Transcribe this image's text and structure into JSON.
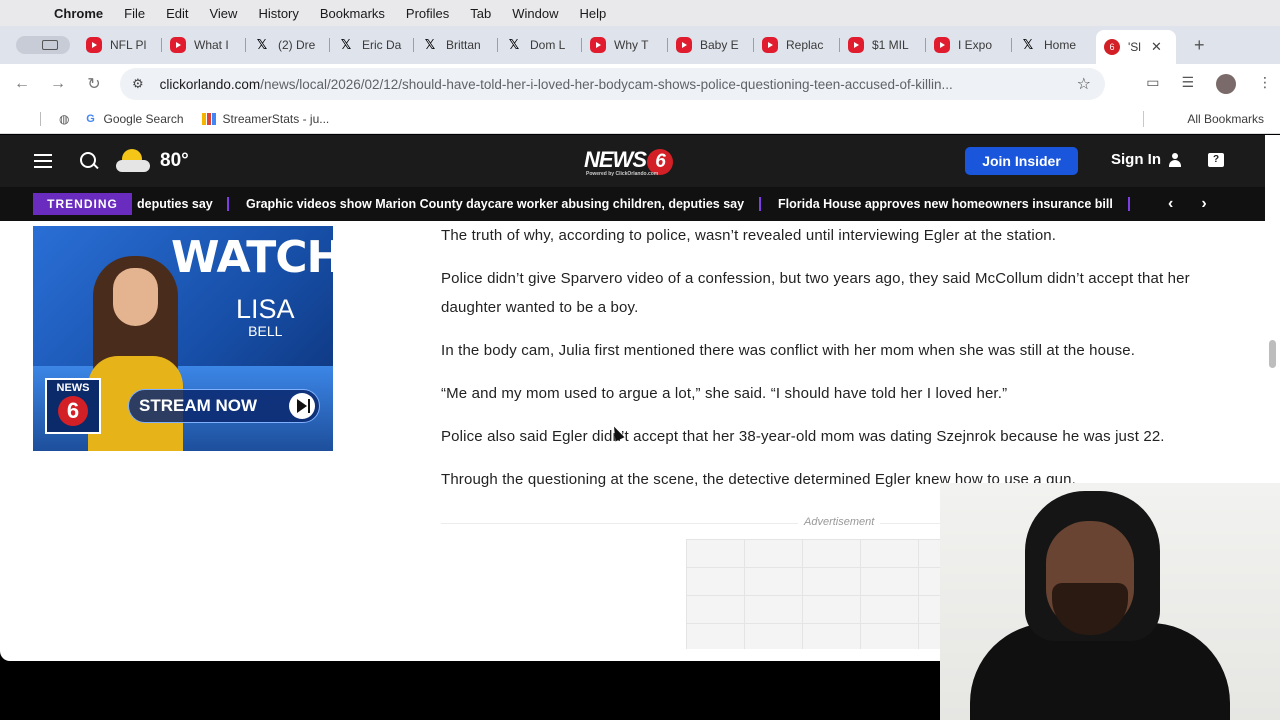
{
  "menubar": {
    "app": "Chrome",
    "items": [
      "File",
      "Edit",
      "View",
      "History",
      "Bookmarks",
      "Profiles",
      "Tab",
      "Window",
      "Help"
    ]
  },
  "tabs": [
    {
      "label": "NFL Pl",
      "icon": "youtube-icon"
    },
    {
      "label": "What I",
      "icon": "youtube-icon"
    },
    {
      "label": "(2) Dre",
      "icon": "x-icon"
    },
    {
      "label": "Eric Da",
      "icon": "x-icon"
    },
    {
      "label": "Brittan",
      "icon": "x-icon"
    },
    {
      "label": "Dom L",
      "icon": "x-icon"
    },
    {
      "label": "Why T",
      "icon": "youtube-icon"
    },
    {
      "label": "Baby E",
      "icon": "youtube-icon"
    },
    {
      "label": "Replac",
      "icon": "youtube-icon"
    },
    {
      "label": "$1 MIL",
      "icon": "youtube-icon"
    },
    {
      "label": "I Expo",
      "icon": "youtube-icon"
    },
    {
      "label": "Home",
      "icon": "x-icon"
    },
    {
      "label": "'Sl",
      "icon": "news6-icon",
      "active": true
    }
  ],
  "address": {
    "host": "clickorlando.com",
    "path": "/news/local/2026/02/12/should-have-told-her-i-loved-her-bodycam-shows-police-questioning-teen-accused-of-killin..."
  },
  "bookmarks": {
    "items": [
      "Google Search",
      "StreamerStats - ju..."
    ],
    "all": "All Bookmarks"
  },
  "site": {
    "temperature": "80°",
    "logo": "NEWS",
    "logo_digit": "6",
    "logo_sub": "Powered by ClickOrlando.com",
    "join": "Join Insider",
    "signin": "Sign In"
  },
  "trending": {
    "badge": "TRENDING",
    "headlines": [
      "deputies say",
      "Graphic videos show Marion County daycare worker abusing children, deputies say",
      "Florida House approves new homeowners insurance bill"
    ]
  },
  "promo": {
    "watch": "WATCH",
    "name": "LISA",
    "surname": "BELL",
    "badge": "NEWS",
    "badge_digit": "6",
    "cta": "STREAM NOW"
  },
  "article": {
    "paragraphs": [
      "The truth of why, according to police, wasn’t revealed until interviewing Egler at the station.",
      "Police didn’t give Sparvero video of a confession, but two years ago, they said McCollum didn’t accept that her daughter wanted to be a boy.",
      "In the body cam, Julia first mentioned there was conflict with her mom when she was still at the house.",
      "“Me and my mom used to argue a lot,” she said. “I should have told her I loved her.”",
      "Police also said Egler didn’t accept that her 38-year-old mom was dating Szejnrok because he was just 22.",
      "Through the questioning at the scene, the detective determined Egler knew how to use a gun."
    ],
    "ad_label": "Advertisement"
  }
}
